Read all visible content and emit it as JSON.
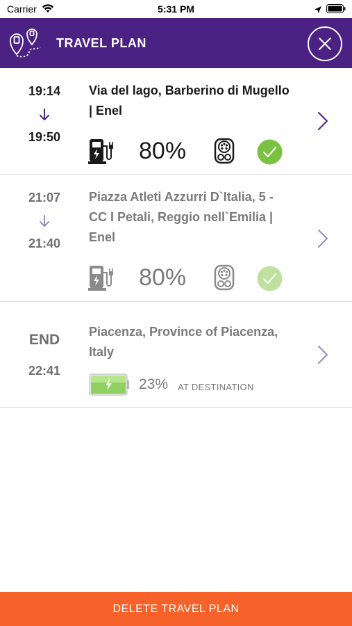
{
  "status_bar": {
    "carrier": "Carrier",
    "time": "5:31 PM"
  },
  "header": {
    "title": "TRAVEL PLAN"
  },
  "colors": {
    "header_bg": "#4b2183",
    "accent": "#4b2183",
    "check": "#7cc242",
    "delete_bg": "#f7622a"
  },
  "stops": [
    {
      "arrival": "19:14",
      "departure": "19:50",
      "address_line1": "Via del lago, Barberino di Mugello",
      "address_line2": "| Enel",
      "charge": "80%",
      "icons": [
        "charger-icon",
        "connector-icon",
        "check-icon",
        "chevron-right-icon"
      ]
    },
    {
      "arrival": "21:07",
      "departure": "21:40",
      "address_line1": "Piazza Atleti Azzurri D`Italia, 5 -",
      "address_line2": "CC I Petali, Reggio nell`Emilia |",
      "address_line3": "Enel",
      "charge": "80%",
      "icons": [
        "charger-icon",
        "connector-icon",
        "check-icon",
        "chevron-right-icon"
      ]
    }
  ],
  "destination": {
    "end_label": "END",
    "arrival": "22:41",
    "address_line1": "Piacenza, Province of Piacenza,",
    "address_line2": "Italy",
    "charge": "23%",
    "charge_label": "AT DESTINATION",
    "battery_level": 0.23
  },
  "actions": {
    "delete_label": "DELETE TRAVEL PLAN"
  }
}
